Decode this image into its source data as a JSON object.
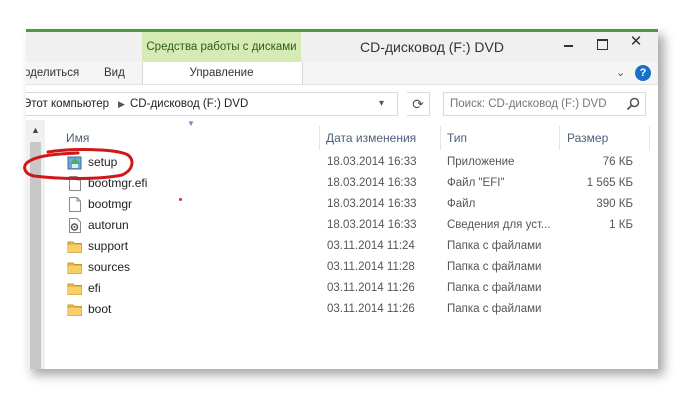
{
  "window": {
    "title": "CD-дисковод (F:) DVD",
    "context_tab": "Средства работы с дисками",
    "minimize_icon": "minimize-icon",
    "maximize_icon": "maximize-icon",
    "close_label": "✕"
  },
  "ribbon": {
    "tabs": [
      "оделиться",
      "Вид",
      "Управление"
    ],
    "help_label": "?",
    "accent": "#4a9c3c",
    "context_color": "#d6eab4"
  },
  "address": {
    "breadcrumbs": [
      "Этот компьютер",
      "CD-дисковод (F:) DVD"
    ],
    "separator": "▶",
    "dropdown": "▾",
    "refresh": "⟳"
  },
  "search": {
    "placeholder": "Поиск: CD-дисковод (F:) DVD"
  },
  "columns": {
    "name": "Имя",
    "date": "Дата изменения",
    "type": "Тип",
    "size": "Размер"
  },
  "files": [
    {
      "name": "setup",
      "date": "18.03.2014 16:33",
      "type": "Приложение",
      "size": "76 КБ",
      "icon": "setup-app-icon"
    },
    {
      "name": "bootmgr.efi",
      "date": "18.03.2014 16:33",
      "type": "Файл \"EFI\"",
      "size": "1 565 КБ",
      "icon": "file-icon"
    },
    {
      "name": "bootmgr",
      "date": "18.03.2014 16:33",
      "type": "Файл",
      "size": "390 КБ",
      "icon": "file-icon"
    },
    {
      "name": "autorun",
      "date": "18.03.2014 16:33",
      "type": "Сведения для уст...",
      "size": "1 КБ",
      "icon": "autorun-settings-icon"
    },
    {
      "name": "support",
      "date": "03.11.2014 11:24",
      "type": "Папка с файлами",
      "size": "",
      "icon": "folder-icon"
    },
    {
      "name": "sources",
      "date": "03.11.2014 11:28",
      "type": "Папка с файлами",
      "size": "",
      "icon": "folder-icon"
    },
    {
      "name": "efi",
      "date": "03.11.2014 11:26",
      "type": "Папка с файлами",
      "size": "",
      "icon": "folder-icon"
    },
    {
      "name": "boot",
      "date": "03.11.2014 11:26",
      "type": "Папка с файлами",
      "size": "",
      "icon": "folder-icon"
    }
  ],
  "annotation": {
    "highlight_color": "#d01818"
  }
}
